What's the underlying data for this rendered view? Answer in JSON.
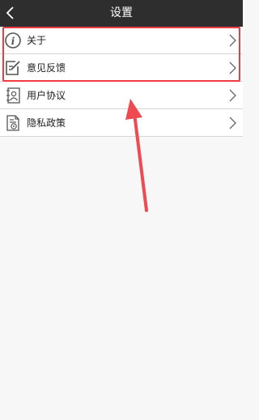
{
  "header": {
    "title": "设置"
  },
  "settings": {
    "items": [
      {
        "label": "关于",
        "icon": "info-icon"
      },
      {
        "label": "意见反馈",
        "icon": "feedback-edit-icon"
      },
      {
        "label": "用户协议",
        "icon": "user-agreement-icon"
      },
      {
        "label": "隐私政策",
        "icon": "privacy-policy-icon"
      }
    ]
  },
  "annotation": {
    "color": "#ee3b45",
    "highlighted_items": [
      "关于",
      "意见反馈"
    ]
  },
  "colors": {
    "header_bg": "#2e2e2e",
    "page_bg": "#f7f7f7",
    "divider": "#d6d6d6"
  }
}
